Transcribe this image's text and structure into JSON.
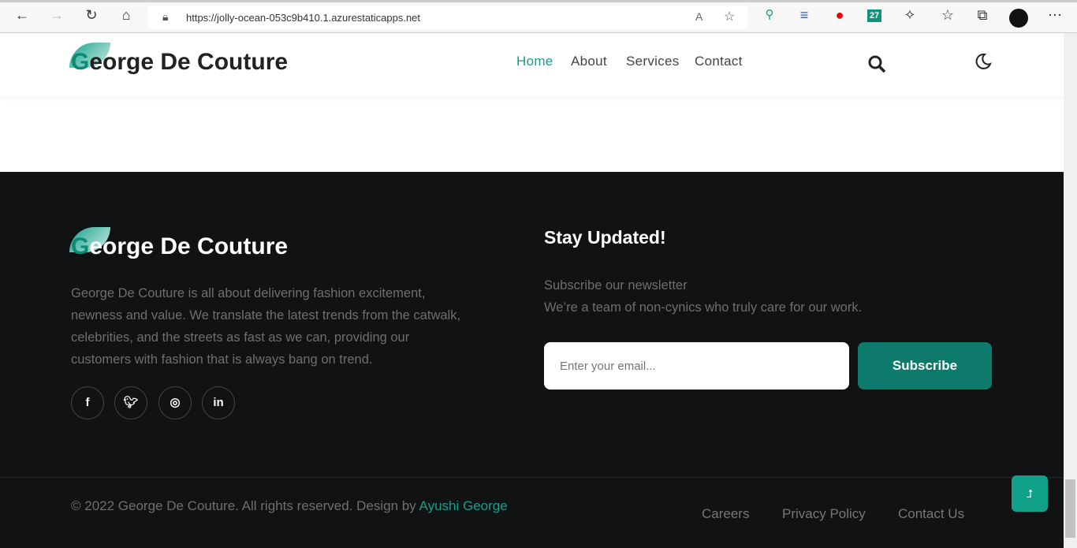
{
  "browser": {
    "url": "https://jolly-ocean-053c9b410.1.azurestaticapps.net"
  },
  "brand": {
    "first_letter": "G",
    "rest": "eorge De Couture"
  },
  "nav": {
    "items": [
      "Home",
      "About",
      "Services",
      "Contact"
    ],
    "active": "Home"
  },
  "footer": {
    "about": "George De Couture is all about delivering fashion excitement, newness and value. We translate the latest trends from the catwalk, celebrities, and the streets as fast as we can, providing our customers with fashion that is always bang on trend.",
    "social": [
      "facebook",
      "twitter",
      "instagram",
      "linkedin"
    ],
    "newsletter": {
      "title": "Stay Updated!",
      "line1": "Subscribe our newsletter",
      "line2": "We’re a team of non-cynics who truly care for our work.",
      "placeholder": "Enter your email...",
      "button": "Subscribe"
    },
    "copyright": "© 2022 George De Couture. All rights reserved. Design by ",
    "author": "Ayushi George",
    "links": [
      "Careers",
      "Privacy Policy",
      "Contact Us"
    ]
  },
  "colors": {
    "accent": "#11a08a",
    "footer_bg": "#111214"
  }
}
